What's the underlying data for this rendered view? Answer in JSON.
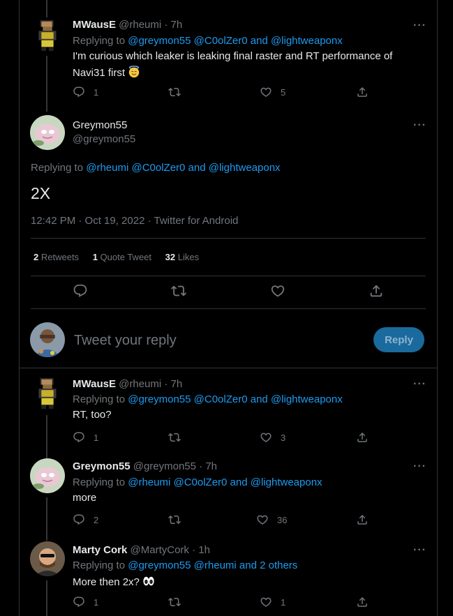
{
  "colors": {
    "accent": "#1d9bf0",
    "muted": "#71767b",
    "text": "#e7e9ea",
    "border": "#2f3336",
    "reply_button_bg": "#1a6a9e"
  },
  "tweet1": {
    "name": "MWausE",
    "handle": "@rheumi",
    "time": "· 7h",
    "reply_prefix": "Replying to",
    "reply_targets": "@greymon55 @C0olZer0 and @lightweaponx",
    "text_line1": "I'm curious which leaker is leaking final raster and RT performance of",
    "text_line2": "Navi31 first",
    "emoji": "smiling-face-with-halo",
    "replies": "1",
    "retweets": "",
    "likes": "5"
  },
  "main": {
    "name": "Greymon55",
    "handle": "@greymon55",
    "reply_prefix": "Replying to",
    "reply_targets": "@rheumi @C0olZer0 and @lightweaponx",
    "text": "2X",
    "timestamp": "12:42 PM · Oct 19, 2022 · Twitter for Android",
    "retweets_count": "2",
    "retweets_label": "Retweets",
    "quote_count": "1",
    "quote_label": "Quote Tweet",
    "likes_count": "32",
    "likes_label": "Likes"
  },
  "composer": {
    "placeholder": "Tweet your reply",
    "button": "Reply"
  },
  "tweet2": {
    "name": "MWausE",
    "handle": "@rheumi",
    "time": "· 7h",
    "reply_prefix": "Replying to",
    "reply_targets": "@greymon55 @C0olZer0 and @lightweaponx",
    "text": "RT, too?",
    "replies": "1",
    "likes": "3"
  },
  "tweet3": {
    "name": "Greymon55",
    "handle": "@greymon55",
    "time": "· 7h",
    "reply_prefix": "Replying to",
    "reply_targets": "@rheumi @C0olZer0 and @lightweaponx",
    "text": "more",
    "replies": "2",
    "likes": "36"
  },
  "tweet4": {
    "name": "Marty Cork",
    "handle": "@MartyCork",
    "time": "· 1h",
    "reply_prefix": "Replying to",
    "reply_targets": "@greymon55 @rheumi and 2 others",
    "text": "More then 2x?",
    "emoji": "eyes",
    "replies": "1",
    "likes": "1"
  }
}
